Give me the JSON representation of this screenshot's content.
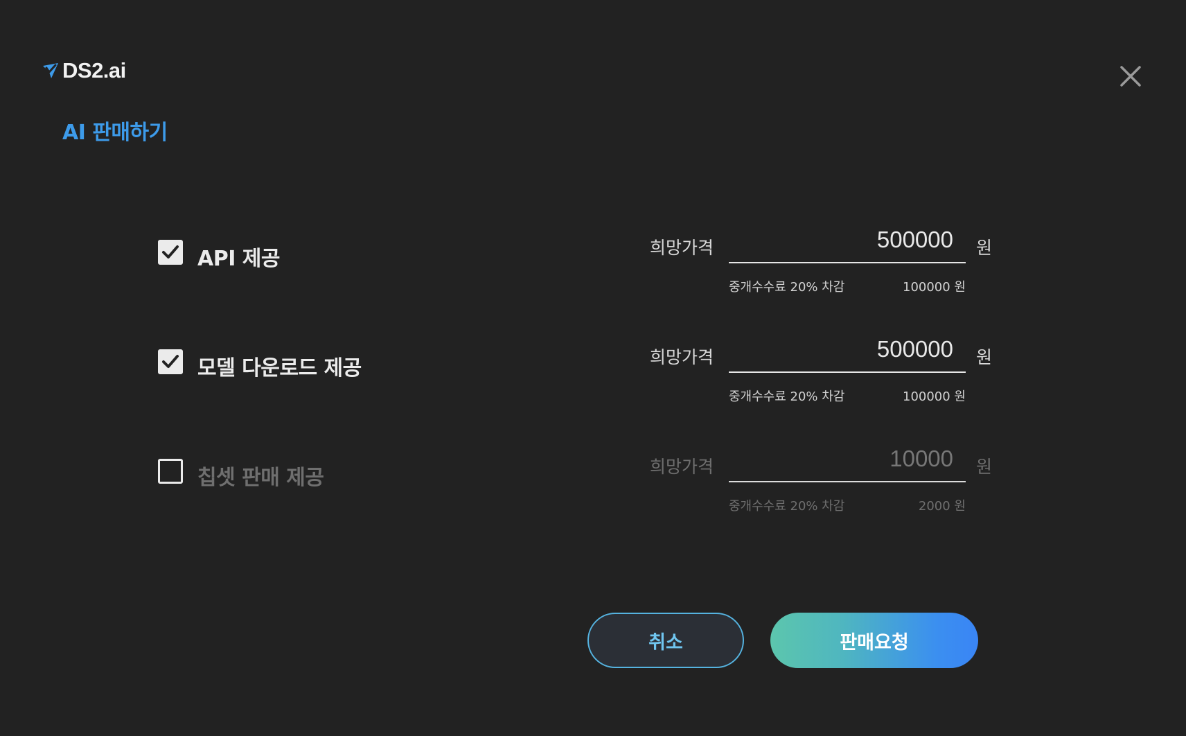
{
  "app": {
    "logo_text": "DS2.ai",
    "logo_icon": "paper-plane-check-icon",
    "close_icon": "close-icon"
  },
  "title": "AI 판매하기",
  "options": [
    {
      "label": "API 제공",
      "checked": true,
      "price_label": "희망가격",
      "price_value": "500000",
      "unit": "원",
      "fee_label": "중개수수료 20% 차감",
      "fee_amount": "100000 원"
    },
    {
      "label": "모델 다운로드 제공",
      "checked": true,
      "price_label": "희망가격",
      "price_value": "500000",
      "unit": "원",
      "fee_label": "중개수수료 20% 차감",
      "fee_amount": "100000 원"
    },
    {
      "label": "칩셋 판매 제공",
      "checked": false,
      "price_label": "희망가격",
      "price_value": "10000",
      "unit": "원",
      "fee_label": "중개수수료 20% 차감",
      "fee_amount": "2000 원"
    }
  ],
  "buttons": {
    "cancel_label": "취소",
    "submit_label": "판매요청"
  },
  "colors": {
    "background": "#222222",
    "accent": "#3d9bea",
    "cancel_border": "#55b3e0",
    "submit_gradient_start": "#5cc6ad",
    "submit_gradient_end": "#3a85f5"
  }
}
